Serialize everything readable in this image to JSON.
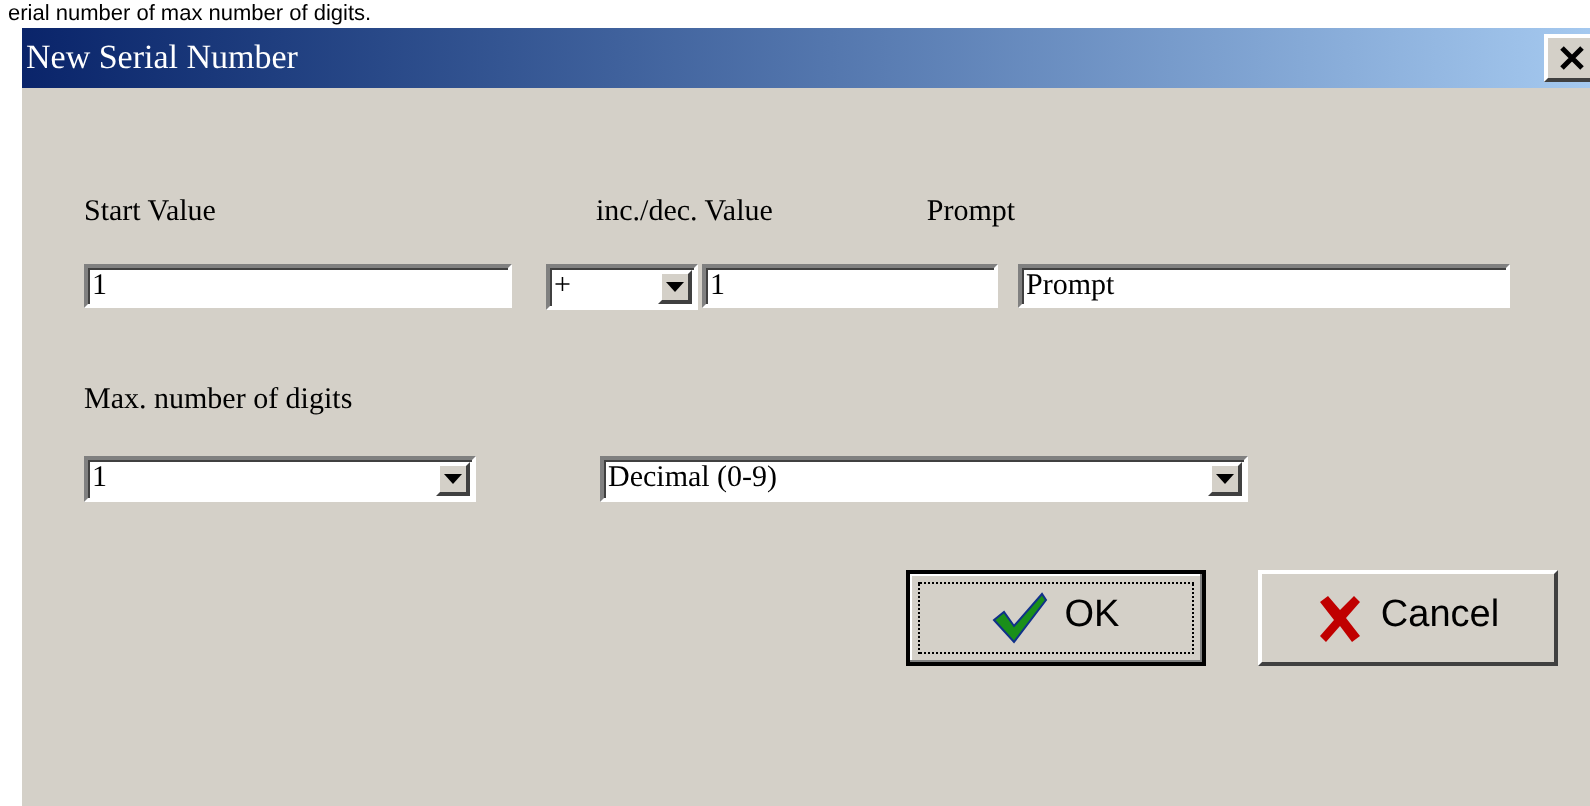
{
  "caption": "erial number of max number of digits.",
  "window": {
    "title": "New Serial Number"
  },
  "start_value": {
    "label": "Start Value",
    "value": "1"
  },
  "increment": {
    "label": "inc./dec. Value",
    "operator": "+",
    "value": "1"
  },
  "prompt": {
    "label": "Prompt",
    "value": "Prompt"
  },
  "max_digits": {
    "label": "Max. number of digits",
    "value": "1"
  },
  "number_format": {
    "value": "Decimal (0-9)"
  },
  "buttons": [
    {
      "label": "OK",
      "kind": "ok",
      "default": true
    },
    {
      "label": "Cancel",
      "kind": "cancel",
      "default": false
    }
  ]
}
